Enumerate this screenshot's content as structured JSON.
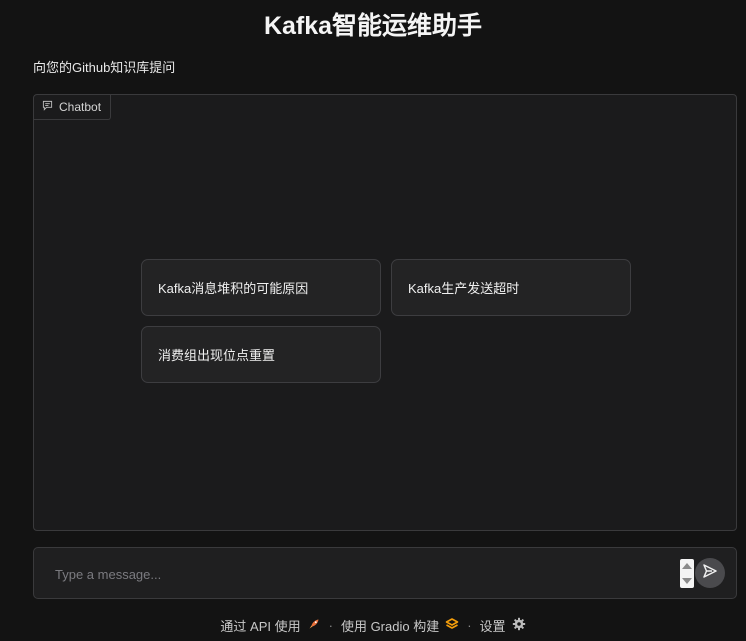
{
  "header": {
    "title": "Kafka智能运维助手",
    "subtitle": "向您的Github知识库提问"
  },
  "chatbot": {
    "label": "Chatbot",
    "label_icon": "chat-icon",
    "examples": [
      "Kafka消息堆积的可能原因",
      "Kafka生产发送超时",
      "消费组出现位点重置"
    ]
  },
  "input": {
    "placeholder": "Type a message...",
    "value": "",
    "send_icon": "send-icon"
  },
  "footer": {
    "api_link": "通过 API 使用",
    "api_icon": "rocket-icon",
    "separator": "·",
    "gradio_link": "使用 Gradio 构建",
    "gradio_icon": "gradio-logo-icon",
    "settings_link": "设置",
    "settings_icon": "gear-icon"
  },
  "colors": {
    "background": "#131313",
    "panel": "#1b1b1c",
    "border": "#3a3a3c",
    "example_bg": "#232324",
    "rocket": "#e8703a",
    "gradio": "#f59e0b"
  }
}
